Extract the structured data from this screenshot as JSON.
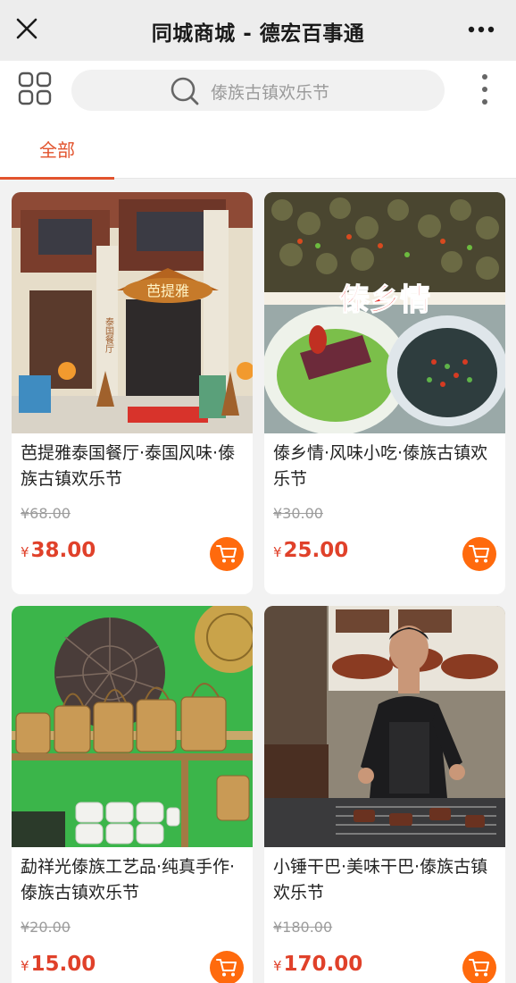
{
  "header": {
    "title": "同城商城 - 德宏百事通"
  },
  "search": {
    "placeholder": "傣族古镇欢乐节"
  },
  "tabs": [
    {
      "label": "全部"
    }
  ],
  "accent_color": "#e2532d",
  "price_color": "#e0412a",
  "cart_color": "#ff6a0d",
  "products": [
    {
      "name": "芭提雅泰国餐厅·泰国风味·傣族古镇欢乐节",
      "original_price": "¥68.00",
      "currency": "¥",
      "price": "38.00",
      "image": {
        "sign_text": "芭提雅",
        "side_text": "泰国餐厅"
      }
    },
    {
      "name": "傣乡情·风味小吃·傣族古镇欢乐节",
      "original_price": "¥30.00",
      "currency": "¥",
      "price": "25.00",
      "image": {
        "overlay_text": "傣乡情"
      }
    },
    {
      "name": "勐祥光傣族工艺品·纯真手作·傣族古镇欢乐节",
      "original_price": "¥20.00",
      "currency": "¥",
      "price": "15.00",
      "image": {}
    },
    {
      "name": "小锤干巴·美味干巴·傣族古镇欢乐节",
      "original_price": "¥180.00",
      "currency": "¥",
      "price": "170.00",
      "image": {}
    }
  ]
}
